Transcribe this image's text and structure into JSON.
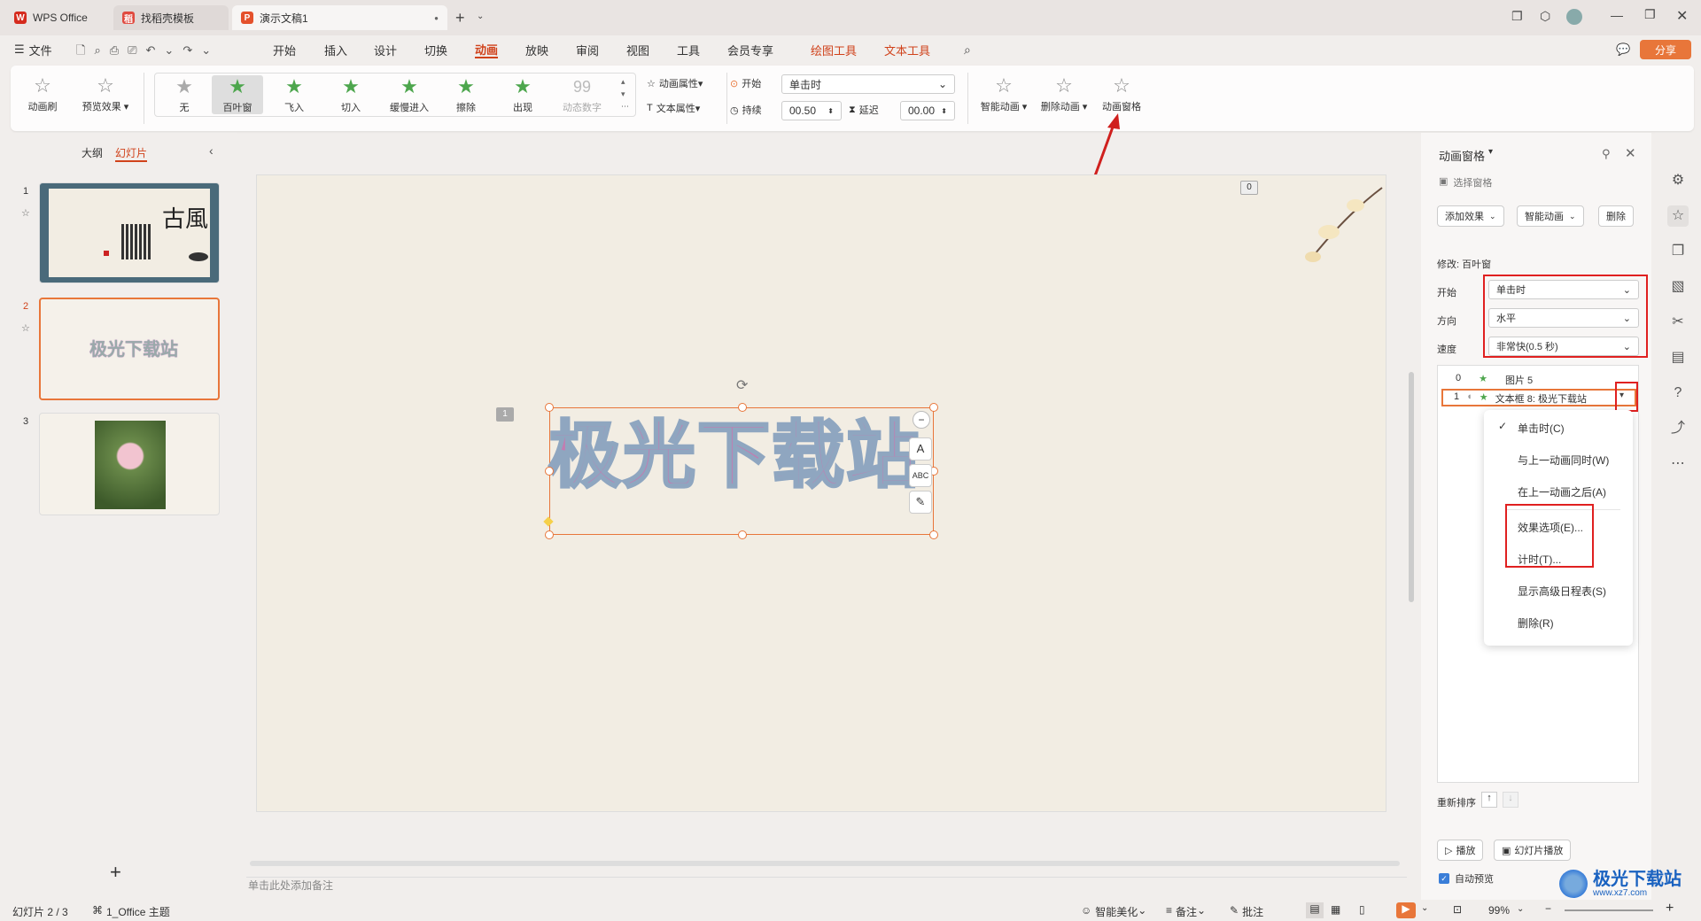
{
  "tabs": [
    {
      "label": "WPS Office"
    },
    {
      "label": "找稻壳模板"
    },
    {
      "label": "演示文稿1"
    }
  ],
  "menu": {
    "file": "文件",
    "items": [
      "开始",
      "插入",
      "设计",
      "切换",
      "动画",
      "放映",
      "审阅",
      "视图",
      "工具",
      "会员专享"
    ],
    "drawing_tools": "绘图工具",
    "text_tools": "文本工具",
    "share": "分享"
  },
  "ribbon": {
    "anim_brush": "动画刷",
    "preview": "预览效果",
    "effects": [
      "无",
      "百叶窗",
      "飞入",
      "切入",
      "缓慢进入",
      "擦除",
      "出现",
      "动态数字"
    ],
    "anim_props": "动画属性",
    "text_props": "文本属性",
    "start_label": "开始",
    "start_value": "单击时",
    "duration_label": "持续",
    "duration_value": "00.50",
    "delay_label": "延迟",
    "delay_value": "00.00",
    "smart_anim": "智能动画",
    "delete_anim": "删除动画",
    "anim_pane": "动画窗格"
  },
  "leftpanel": {
    "outline": "大纲",
    "slides": "幻灯片",
    "numbers": [
      "1",
      "2",
      "3"
    ],
    "thumb2_text": "极光下载站",
    "thumb1_title": "古風"
  },
  "slide": {
    "main_text": "极光下载站",
    "badge_top": "0",
    "badge_left": "1"
  },
  "notes_placeholder": "单击此处添加备注",
  "rightpanel": {
    "title": "动画窗格",
    "select_pane": "选择窗格",
    "add_effect": "添加效果",
    "smart_anim": "智能动画",
    "delete": "删除",
    "modify": "修改: 百叶窗",
    "start_label": "开始",
    "start_value": "单击时",
    "direction_label": "方向",
    "direction_value": "水平",
    "speed_label": "速度",
    "speed_value": "非常快(0.5 秒)",
    "list": [
      {
        "num": "0",
        "name": "图片 5"
      },
      {
        "num": "1",
        "name": "文本框 8: 极光下载站"
      }
    ],
    "reorder": "重新排序",
    "play": "播放",
    "slideshow": "幻灯片播放",
    "auto_preview": "自动预览"
  },
  "context_menu": [
    "单击时(C)",
    "与上一动画同时(W)",
    "在上一动画之后(A)",
    "效果选项(E)...",
    "计时(T)...",
    "显示高级日程表(S)",
    "删除(R)"
  ],
  "status": {
    "slide": "幻灯片 2 / 3",
    "theme": "1_Office 主题",
    "beautify": "智能美化",
    "notes": "备注",
    "comment": "批注",
    "zoom": "99%"
  },
  "watermark": "极光下载站",
  "watermark_url": "www.xz7.com"
}
